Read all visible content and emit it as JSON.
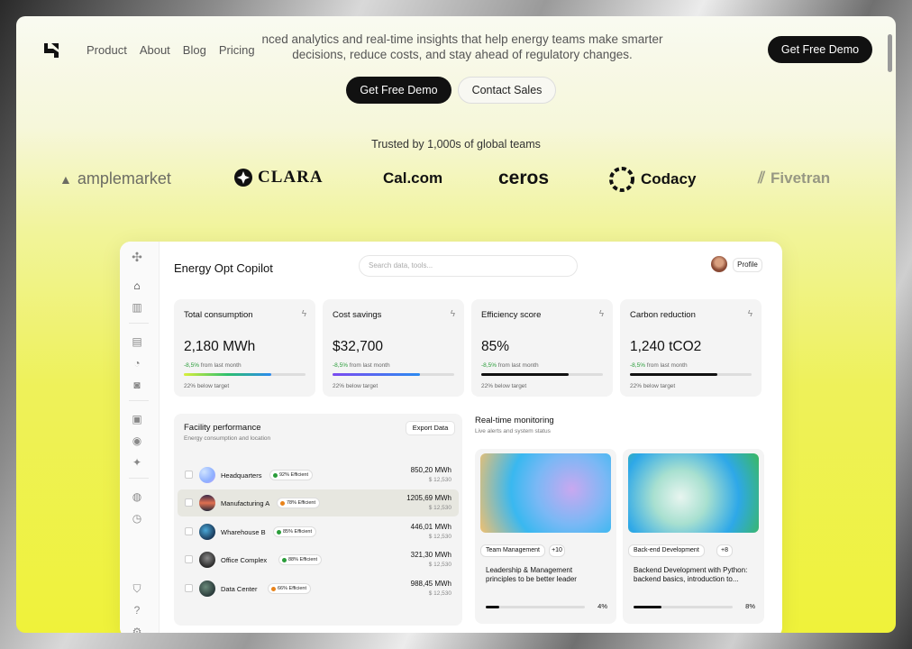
{
  "nav": {
    "items": [
      "Product",
      "About",
      "Blog",
      "Pricing"
    ],
    "cta": "Get Free Demo"
  },
  "hero": {
    "subtitle": "nced analytics and real-time insights that help energy teams make smarter decisions, reduce costs, and stay ahead of regulatory changes.",
    "primary_cta": "Get Free Demo",
    "secondary_cta": "Contact Sales"
  },
  "trusted": {
    "label": "Trusted by 1,000s of global teams",
    "logos": [
      "amplemarket",
      "CLARA",
      "Cal.com",
      "ceros",
      "Codacy",
      "Fivetran"
    ]
  },
  "app": {
    "title": "Energy Opt Copilot",
    "search_placeholder": "Search data, tools...",
    "profile_label": "Profile",
    "stats": [
      {
        "title": "Total consumption",
        "value": "2,180 MWh",
        "change": "-8,5%",
        "change_suffix": "from last month",
        "progress": 0.72,
        "bar_color": "gradient-green-blue",
        "footnote": "22% below target"
      },
      {
        "title": "Cost savings",
        "value": "$32,700",
        "change": "-8,5%",
        "change_suffix": "from last month",
        "progress": 0.72,
        "bar_color": "gradient-purple-blue",
        "footnote": "22% below target"
      },
      {
        "title": "Efficiency score",
        "value": "85%",
        "change": "-8,5%",
        "change_suffix": "from last month",
        "progress": 0.72,
        "bar_color": "#111111",
        "footnote": "22% below target"
      },
      {
        "title": "Carbon reduction",
        "value": "1,240 tCO2",
        "change": "-8,5%",
        "change_suffix": "from last month",
        "progress": 0.72,
        "bar_color": "#111111",
        "footnote": "22% below target"
      }
    ],
    "facility": {
      "title": "Facility performance",
      "subtitle": "Energy consumption and location",
      "export_label": "Export Data",
      "rows": [
        {
          "name": "Headquarters",
          "badge": "92% Efficient",
          "dot": "#2a9d3a",
          "value": "850,20 MWh",
          "cost": "$ 12,530",
          "selected": false
        },
        {
          "name": "Manufacturing A",
          "badge": "78% Efficient",
          "dot": "#e8831a",
          "value": "1205,69 MWh",
          "cost": "$ 12,530",
          "selected": true
        },
        {
          "name": "Wharehouse B",
          "badge": "85% Efficient",
          "dot": "#2a9d3a",
          "value": "446,01 MWh",
          "cost": "$ 12,530",
          "selected": false
        },
        {
          "name": "Office Complex",
          "badge": "88% Efficient",
          "dot": "#2a9d3a",
          "value": "321,30 MWh",
          "cost": "$ 12,530",
          "selected": false
        },
        {
          "name": "Data Center",
          "badge": "66% Efficient",
          "dot": "#e8831a",
          "value": "988,45 MWh",
          "cost": "$ 12,530",
          "selected": false
        }
      ]
    },
    "monitoring": {
      "title": "Real-time monitoring",
      "subtitle": "Live alerts and system status",
      "cards": [
        {
          "tag": "Team Management",
          "count": "+10",
          "description": "Leadership & Management principles to be better leader",
          "progress_label": "4%",
          "progress": 0.04
        },
        {
          "tag": "Back-end Development",
          "count": "+8",
          "description": "Backend Development with Python: backend basics, introduction to...",
          "progress_label": "8%",
          "progress": 0.08
        }
      ]
    }
  },
  "icons": [
    "home-icon",
    "chart-icon",
    "building-icon",
    "gauge-icon",
    "pulse-icon",
    "document-icon",
    "bell-icon",
    "sparkle-icon",
    "location-icon",
    "history-icon",
    "shield-icon",
    "help-icon",
    "settings-icon",
    "bolt-icon"
  ]
}
